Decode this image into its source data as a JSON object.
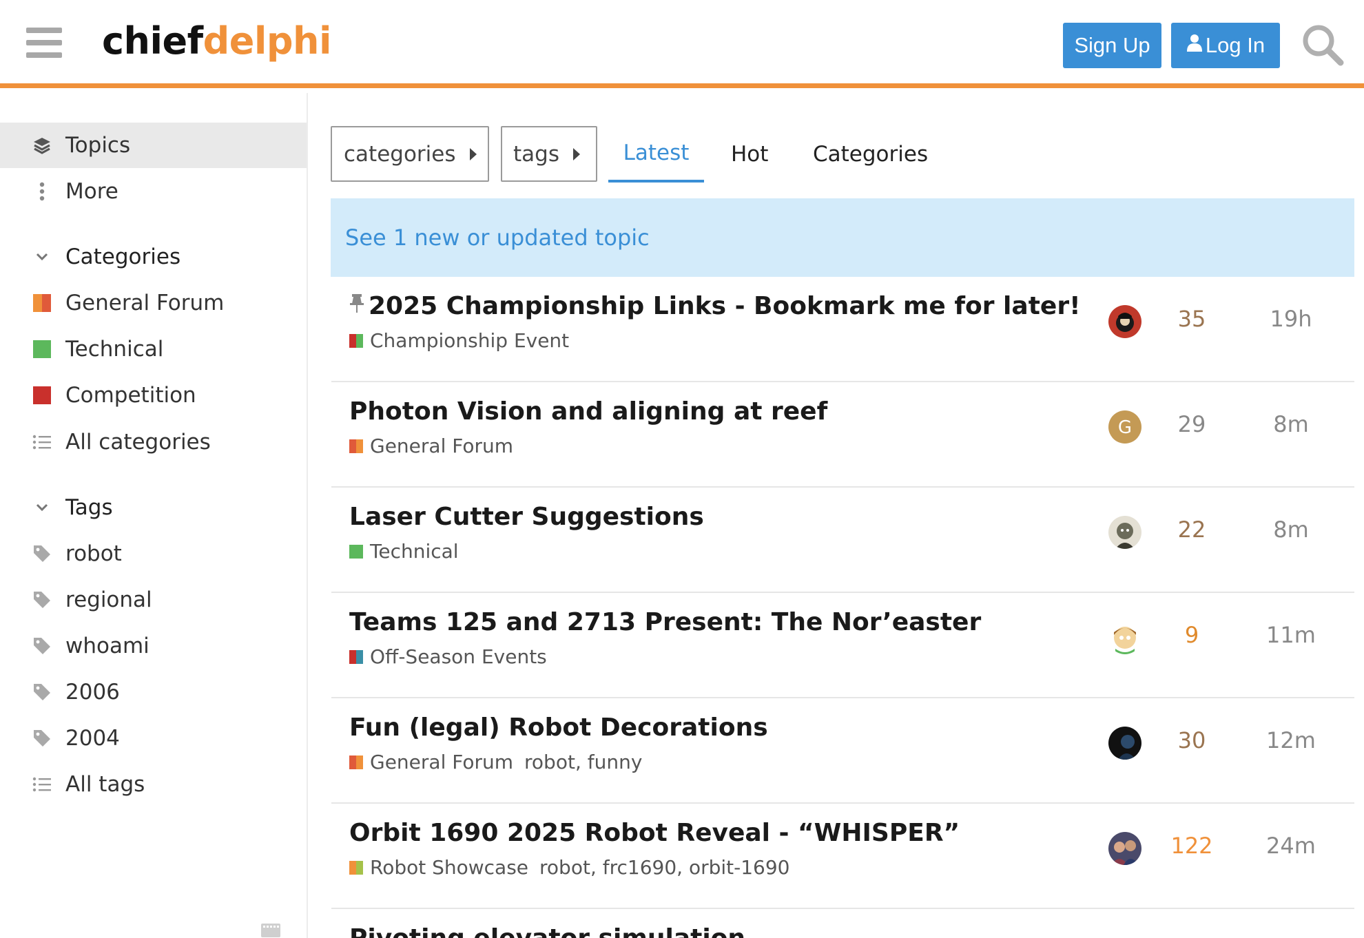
{
  "header": {
    "logo_part1": "chief",
    "logo_part2": "delphi",
    "signup_label": "Sign Up",
    "login_label": "Log In"
  },
  "sidebar": {
    "topics_label": "Topics",
    "more_label": "More",
    "categories_heading": "Categories",
    "categories": [
      {
        "label": "General Forum",
        "colors": [
          "#f0913a",
          "#e05a3a"
        ]
      },
      {
        "label": "Technical",
        "colors": [
          "#5cb85c",
          "#5cb85c"
        ]
      },
      {
        "label": "Competition",
        "colors": [
          "#c9302c",
          "#c9302c"
        ]
      }
    ],
    "all_categories_label": "All categories",
    "tags_heading": "Tags",
    "tags": [
      "robot",
      "regional",
      "whoami",
      "2006",
      "2004"
    ],
    "all_tags_label": "All tags"
  },
  "nav": {
    "categories_dropdown": "categories",
    "tags_dropdown": "tags",
    "tabs": [
      "Latest",
      "Hot",
      "Categories"
    ]
  },
  "banner": {
    "text": "See 1 new or updated topic"
  },
  "topics": [
    {
      "title": "2025 Championship Links - Bookmark me for later!",
      "pinned": true,
      "category": "Championship Event",
      "cat_colors": [
        "#c9302c",
        "#5cb85c"
      ],
      "tags": "",
      "replies": "35",
      "activity": "19h"
    },
    {
      "title": "Photon Vision and aligning at reef",
      "pinned": false,
      "category": "General Forum",
      "cat_colors": [
        "#e05a3a",
        "#f0913a"
      ],
      "tags": "",
      "replies": "29",
      "activity": "8m"
    },
    {
      "title": "Laser Cutter Suggestions",
      "pinned": false,
      "category": "Technical",
      "cat_colors": [
        "#5cb85c",
        "#5cb85c"
      ],
      "tags": "",
      "replies": "22",
      "activity": "8m"
    },
    {
      "title": "Teams 125 and 2713 Present: The Nor’easter",
      "pinned": false,
      "category": "Off-Season Events",
      "cat_colors": [
        "#c9302c",
        "#3a8fd6"
      ],
      "tags": "",
      "replies": "9",
      "activity": "11m"
    },
    {
      "title": "Fun (legal) Robot Decorations",
      "pinned": false,
      "category": "General Forum",
      "cat_colors": [
        "#e05a3a",
        "#f0913a"
      ],
      "tags": "robot, funny",
      "replies": "30",
      "activity": "12m"
    },
    {
      "title": "Orbit 1690 2025 Robot Reveal - “WHISPER”",
      "pinned": false,
      "category": "Robot Showcase",
      "cat_colors": [
        "#f0913a",
        "#5cb85c"
      ],
      "tags": "robot, frc1690, orbit-1690",
      "replies": "122",
      "activity": "24m"
    },
    {
      "title": "Pivoting elevator simulation",
      "pinned": false,
      "category": "",
      "cat_colors": [
        "#5cb85c",
        "#5cb85c"
      ],
      "tags": "",
      "replies": "",
      "activity": ""
    }
  ],
  "avatars": [
    {
      "initial": "",
      "colors": [
        "#c0392b",
        "#1a1a1a"
      ]
    },
    {
      "initial": "G",
      "colors": [
        "#c49a55",
        "#c49a55"
      ]
    },
    {
      "initial": "",
      "colors": [
        "#556b55",
        "#d9d2c0"
      ]
    },
    {
      "initial": "",
      "colors": [
        "#f2d39b",
        "#5cb85c"
      ]
    },
    {
      "initial": "",
      "colors": [
        "#111",
        "#2c4a6b"
      ]
    },
    {
      "initial": "",
      "colors": [
        "#6b5560",
        "#3a3a5a"
      ]
    }
  ]
}
